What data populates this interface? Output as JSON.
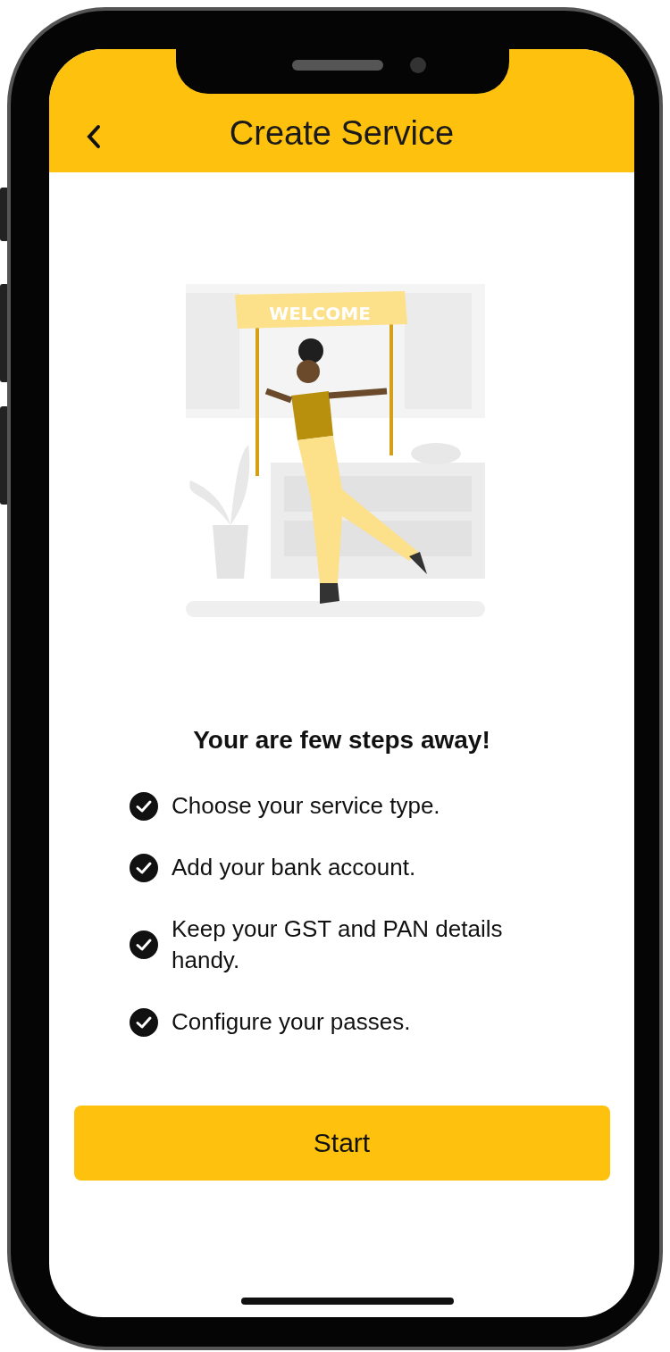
{
  "header": {
    "title": "Create Service"
  },
  "illustration": {
    "banner_text": "WELCOME"
  },
  "heading": "Your are few steps away!",
  "steps": [
    {
      "text": "Choose your service type.",
      "checked": true
    },
    {
      "text": "Add your bank account.",
      "checked": true
    },
    {
      "text": "Keep your GST and PAN details handy.",
      "checked": true
    },
    {
      "text": "Configure your passes.",
      "checked": true
    }
  ],
  "primary_button": "Start"
}
